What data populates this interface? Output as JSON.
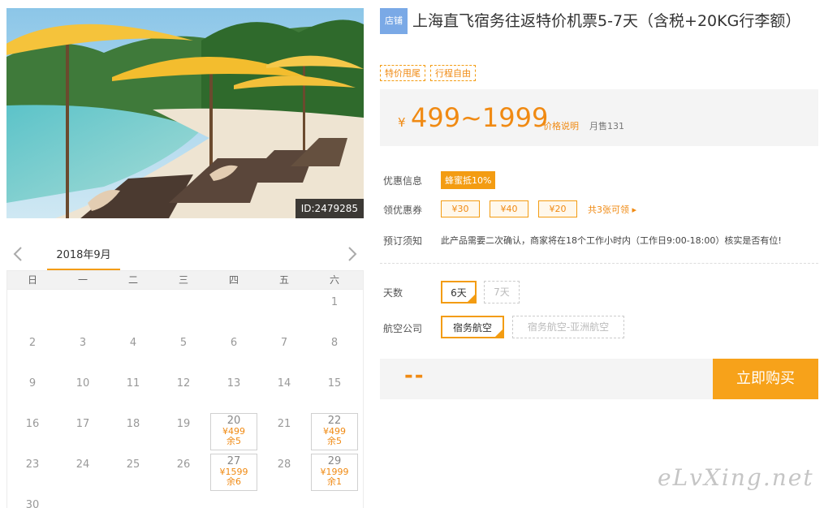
{
  "photo": {
    "id_label": "ID:2479285"
  },
  "calendar": {
    "month": "2018年9月",
    "weekdays": [
      "日",
      "一",
      "二",
      "三",
      "四",
      "五",
      "六"
    ],
    "days": [
      {
        "n": "1"
      },
      {
        "n": "2"
      },
      {
        "n": "3"
      },
      {
        "n": "4"
      },
      {
        "n": "5"
      },
      {
        "n": "6"
      },
      {
        "n": "7"
      },
      {
        "n": "8"
      },
      {
        "n": "9"
      },
      {
        "n": "10"
      },
      {
        "n": "11"
      },
      {
        "n": "12"
      },
      {
        "n": "13"
      },
      {
        "n": "14"
      },
      {
        "n": "15"
      },
      {
        "n": "16"
      },
      {
        "n": "17"
      },
      {
        "n": "18"
      },
      {
        "n": "19"
      },
      {
        "n": "20",
        "price": "¥499",
        "left": "余5"
      },
      {
        "n": "21"
      },
      {
        "n": "22",
        "price": "¥499",
        "left": "余5"
      },
      {
        "n": "23"
      },
      {
        "n": "24"
      },
      {
        "n": "25"
      },
      {
        "n": "26"
      },
      {
        "n": "27",
        "price": "¥1599",
        "left": "余6"
      },
      {
        "n": "28"
      },
      {
        "n": "29",
        "price": "¥1999",
        "left": "余1"
      },
      {
        "n": "30"
      }
    ],
    "first_weekday": 6
  },
  "product": {
    "shop_tag": "店铺",
    "title": "上海直飞宿务往返特价机票5-7天（含税+20KG行李额）",
    "tags": [
      "特价甩尾",
      "行程自由"
    ]
  },
  "price": {
    "symbol": "¥",
    "range": "499~1999",
    "note": "价格说明",
    "sales": "月售131"
  },
  "discount": {
    "label": "优惠信息",
    "badge": "蜂蜜抵10%"
  },
  "coupons": {
    "label": "领优惠券",
    "items": [
      "¥30",
      "¥40",
      "¥20"
    ],
    "more": "共3张可领 ▸"
  },
  "notice": {
    "label": "预订须知",
    "text": "此产品需要二次确认，商家将在18个工作小时内（工作日9:00-18:00）核实是否有位!"
  },
  "days_option": {
    "label": "天数",
    "options": [
      "6天",
      "7天"
    ]
  },
  "airline": {
    "label": "航空公司",
    "options": [
      "宿务航空",
      "宿务航空-亚洲航空"
    ]
  },
  "buy": {
    "total": "--",
    "button": "立即购买"
  },
  "watermark": "eLvXing.net",
  "colors": {
    "accent": "#f39c12",
    "price": "#f08a13",
    "button": "#f7a21a",
    "shop_tag": "#7aa9e6"
  }
}
